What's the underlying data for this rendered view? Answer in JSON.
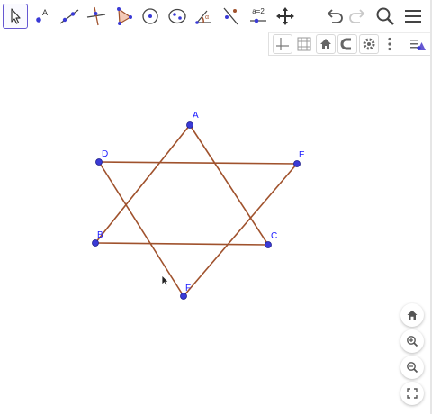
{
  "toolbar": {
    "tools": [
      {
        "name": "move-tool",
        "label": ""
      },
      {
        "name": "point-tool",
        "label": "A"
      },
      {
        "name": "line-tool",
        "label": ""
      },
      {
        "name": "perpendicular-line-tool",
        "label": ""
      },
      {
        "name": "polygon-tool",
        "label": ""
      },
      {
        "name": "circle-center-point-tool",
        "label": ""
      },
      {
        "name": "ellipse-tool",
        "label": ""
      },
      {
        "name": "angle-tool",
        "label": ""
      },
      {
        "name": "reflect-tool",
        "label": ""
      },
      {
        "name": "slider-tool",
        "label": "a=2"
      },
      {
        "name": "move-graphics-view-tool",
        "label": ""
      }
    ],
    "selected_tool": "move-tool",
    "eq_label": "a=2"
  },
  "point_labels": {
    "A": "A",
    "B": "B",
    "C": "C",
    "D": "D",
    "E": "E",
    "F": "F"
  },
  "colors": {
    "segment": "#a0522d",
    "point_fill": "#3a3ad6",
    "point_label": "#1a1aff",
    "selected_tool_border": "#6557d2"
  },
  "icons": {
    "undo": "undo-icon",
    "redo": "redo-icon",
    "search": "search-icon",
    "menu": "hamburger-menu-icon"
  }
}
